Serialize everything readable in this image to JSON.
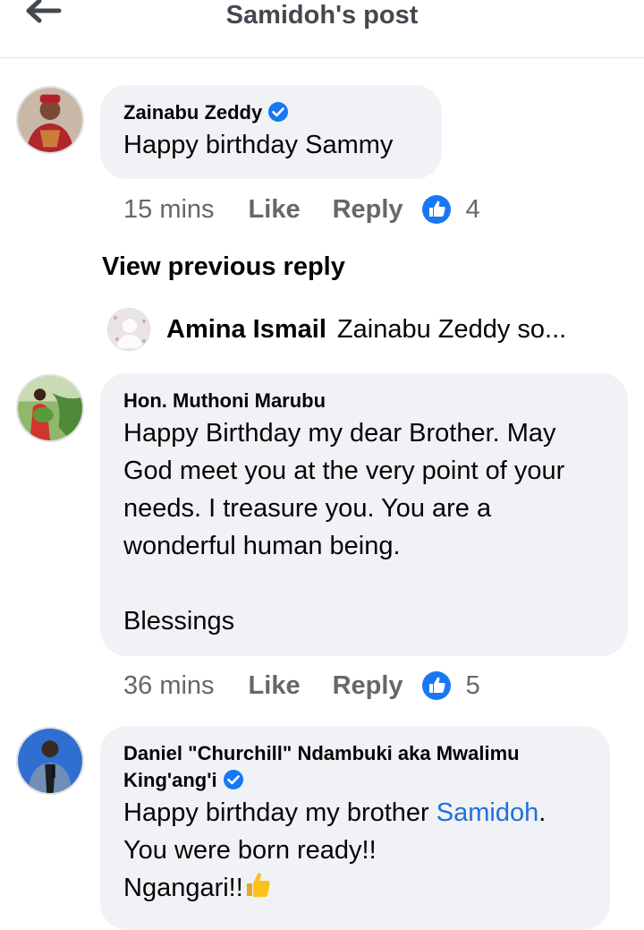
{
  "header": {
    "title": "Samidoh's post"
  },
  "comments": [
    {
      "author": "Zainabu Zeddy",
      "verified": true,
      "text": "Happy birthday Sammy",
      "time": "15 mins",
      "like_label": "Like",
      "reply_label": "Reply",
      "reaction_count": "4"
    },
    {
      "author": "Hon. Muthoni Marubu",
      "verified": false,
      "text": "Happy Birthday my dear Brother. May God meet you at the very point of your needs. I treasure you. You are a wonderful human being.",
      "text2": "Blessings",
      "time": "36 mins",
      "like_label": "Like",
      "reply_label": "Reply",
      "reaction_count": "5"
    },
    {
      "author": "Daniel \"Churchill\" Ndambuki aka Mwalimu King'ang'i",
      "verified": true,
      "text_before": "Happy birthday my brother ",
      "mention": "Samidoh",
      "text_after": ".",
      "line2": "You were born ready!!",
      "line3": "Ngangari!!"
    }
  ],
  "view_previous": "View previous reply",
  "reply_preview": {
    "author": "Amina Ismail",
    "text": "Zainabu Zeddy so..."
  },
  "colors": {
    "link": "#216fdb",
    "verified": "#1877f2",
    "bubble": "#f0f2f5",
    "meta": "#65676b"
  },
  "icons": {
    "back": "arrow-left-icon",
    "like": "like-thumb-icon",
    "verified": "verified-badge-icon",
    "emoji": "thumbs-up-emoji"
  }
}
